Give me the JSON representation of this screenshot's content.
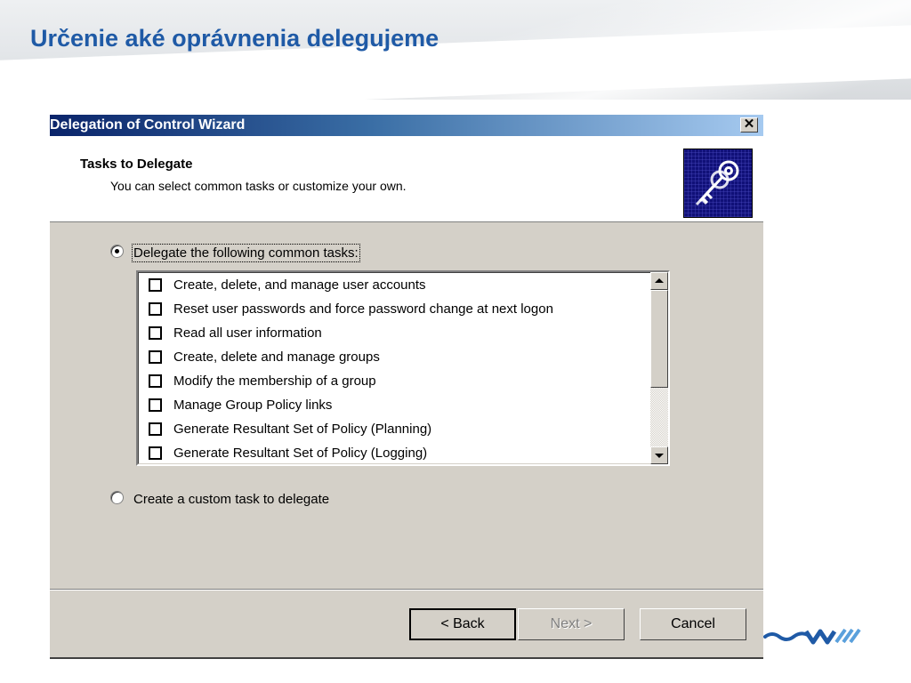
{
  "slide": {
    "title": "Určenie aké oprávnenia delegujeme"
  },
  "dialog": {
    "title": "Delegation of Control Wizard",
    "close_label": "✕",
    "header": {
      "title": "Tasks to Delegate",
      "subtitle": "You can select common tasks or customize your own."
    },
    "option_common": {
      "label": "Delegate the following common tasks:",
      "selected": true
    },
    "tasks": [
      {
        "label": "Create, delete, and manage user accounts",
        "checked": false
      },
      {
        "label": "Reset user passwords and force password change at next logon",
        "checked": false
      },
      {
        "label": "Read all user information",
        "checked": false
      },
      {
        "label": "Create, delete and manage groups",
        "checked": false
      },
      {
        "label": "Modify the membership of a group",
        "checked": false
      },
      {
        "label": "Manage Group Policy links",
        "checked": false
      },
      {
        "label": "Generate Resultant Set of Policy (Planning)",
        "checked": false
      },
      {
        "label": "Generate Resultant Set of Policy (Logging)",
        "checked": false
      }
    ],
    "option_custom": {
      "label": "Create a custom task to delegate",
      "selected": false
    },
    "buttons": {
      "back": "< Back",
      "next": "Next >",
      "cancel": "Cancel"
    }
  },
  "colors": {
    "slide_title": "#1f5aa6",
    "dialog_face": "#d4d0c8",
    "titlebar_start": "#0a246a",
    "titlebar_end": "#a6caf0",
    "key_icon_bg": "#101078",
    "logo_blue": "#1f5aa6"
  },
  "icons": [
    "keys-icon",
    "close-icon",
    "scroll-up-icon",
    "scroll-down-icon",
    "company-logo"
  ]
}
